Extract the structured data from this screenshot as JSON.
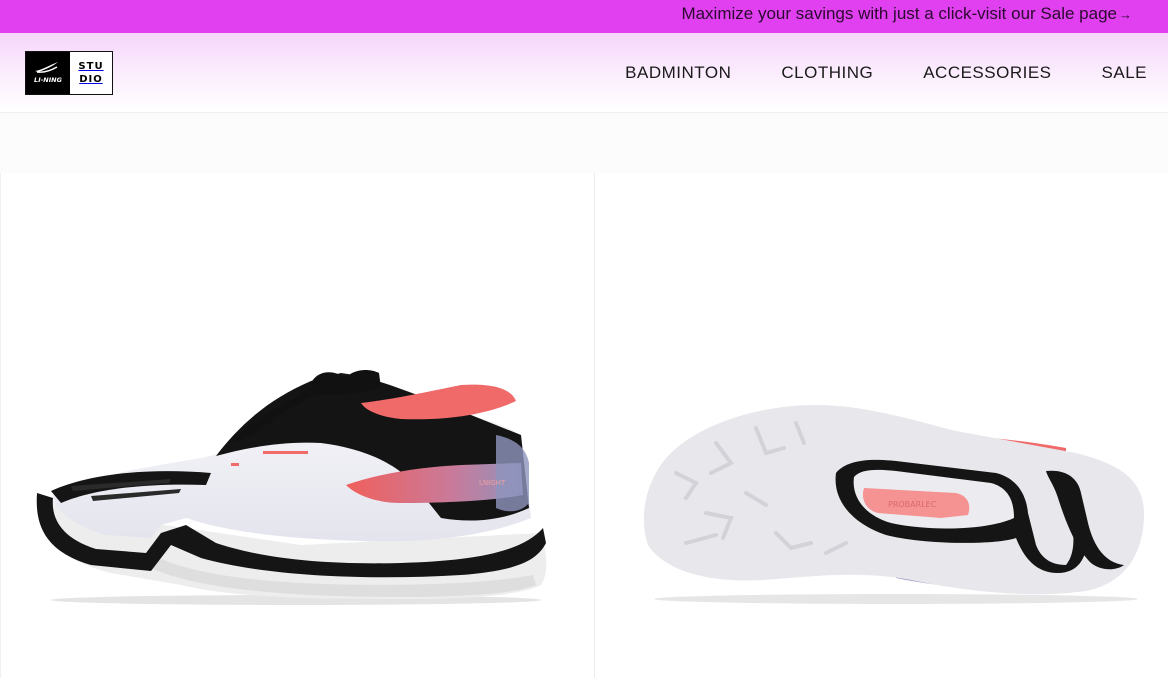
{
  "promo": {
    "text": "Maximize your savings with just a click-visit our Sale page",
    "arrow": "→"
  },
  "brand": {
    "logo_mark_text": "LI-NING",
    "studio_line1": "STU",
    "studio_line2": "DIO"
  },
  "nav": {
    "items": [
      {
        "label": "BADMINTON"
      },
      {
        "label": "CLOTHING"
      },
      {
        "label": "ACCESSORIES"
      },
      {
        "label": "SALE"
      }
    ]
  },
  "gallery": {
    "images": [
      {
        "view": "side",
        "shoe_text": "LNIGHT"
      },
      {
        "view": "sole",
        "sole_text": "PROBARLEC"
      }
    ]
  },
  "colors": {
    "promo_bg": "#e040f0",
    "accent_coral": "#f06a6a",
    "shoe_black": "#111111",
    "shoe_white": "#ececf2"
  }
}
